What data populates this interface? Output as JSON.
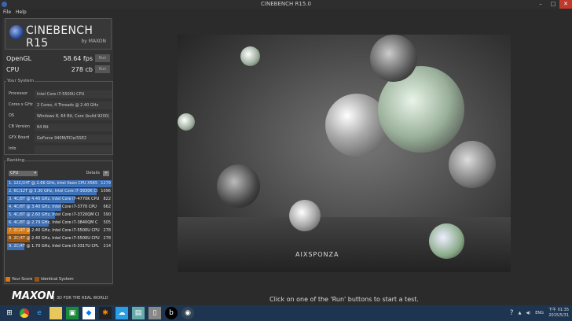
{
  "window": {
    "title": "CINEBENCH R15.0",
    "minimize": "–",
    "maximize": "□",
    "close": "✕"
  },
  "menu": [
    "File",
    "Help"
  ],
  "logo": {
    "name": "CINEBENCH R15",
    "by": "by MAXON"
  },
  "scores": [
    {
      "label": "OpenGL",
      "value": "58.64 fps",
      "run": "Run"
    },
    {
      "label": "CPU",
      "value": "278 cb",
      "run": "Run"
    }
  ],
  "system": {
    "title": "Your System",
    "rows": [
      {
        "k": "Processor",
        "v": "Intel Core i7-5500U CPU"
      },
      {
        "k": "Cores x GHz",
        "v": "2 Cores, 4 Threads @ 2.40 GHz"
      },
      {
        "k": "OS",
        "v": "Windows 8, 64 Bit, Core (build 9200)"
      },
      {
        "k": "CB Version",
        "v": "64 Bit"
      },
      {
        "k": "GFX Board",
        "v": "GeForce 940M/PCIe/SSE2"
      },
      {
        "k": "Info",
        "v": ""
      }
    ]
  },
  "ranking": {
    "title": "Ranking",
    "dropdown": "CPU",
    "details": "Details",
    "plus": "+",
    "items": [
      {
        "text": "1. 12C/24T @ 2.66 GHz, Intel Xeon CPU X565",
        "score": 1279,
        "type": "other"
      },
      {
        "text": "2. 6C/12T @ 3.30 GHz,  Intel Core i7-3930K CI",
        "score": 1096,
        "type": "other"
      },
      {
        "text": "3. 4C/8T @ 4.40 GHz, Intel Core i7-4770K CPU",
        "score": 822,
        "type": "other"
      },
      {
        "text": "4. 4C/8T @ 3.40 GHz,  Intel Core i7-3770 CPU",
        "score": 662,
        "type": "other"
      },
      {
        "text": "5. 4C/8T @ 2.60 GHz, Intel Core i7-3720QM CI",
        "score": 590,
        "type": "other"
      },
      {
        "text": "6. 4C/8T @ 2.79 GHz,  Intel Core i7-3840QM C",
        "score": 505,
        "type": "other"
      },
      {
        "text": "7. 2C/4T @ 2.40 GHz, Intel Core i7-5500U CPU",
        "score": 278,
        "type": "yours"
      },
      {
        "text": "8. 2C/4T @ 2.40 GHz, Intel Core i7-5500U CPU",
        "score": 278,
        "type": "identical"
      },
      {
        "text": "9. 2C/4T @ 1.70 GHz,  Intel Core i5-3317U CPL",
        "score": 214,
        "type": "other"
      }
    ]
  },
  "legend": {
    "yours": "Your Score",
    "identical": "Identical System"
  },
  "colors": {
    "other": "#3d6fb5",
    "yours": "#d9780f",
    "identical": "#9a5410"
  },
  "footer": {
    "brand": "MAXON",
    "tagline": "3D FOR THE REAL WORLD"
  },
  "render": {
    "watermark": "AIXSPONZA"
  },
  "status": "Click on one of the 'Run' buttons to start a test.",
  "taskbar": {
    "apps": [
      "windows-start",
      "chrome",
      "internet-explorer",
      "file-explorer",
      "store",
      "dropbox",
      "photos",
      "cloud",
      "remote",
      "folder",
      "beats",
      "cinebench"
    ],
    "tray": {
      "lang": "ENG",
      "time": "下午 01:35",
      "date": "2015/5/31"
    }
  }
}
